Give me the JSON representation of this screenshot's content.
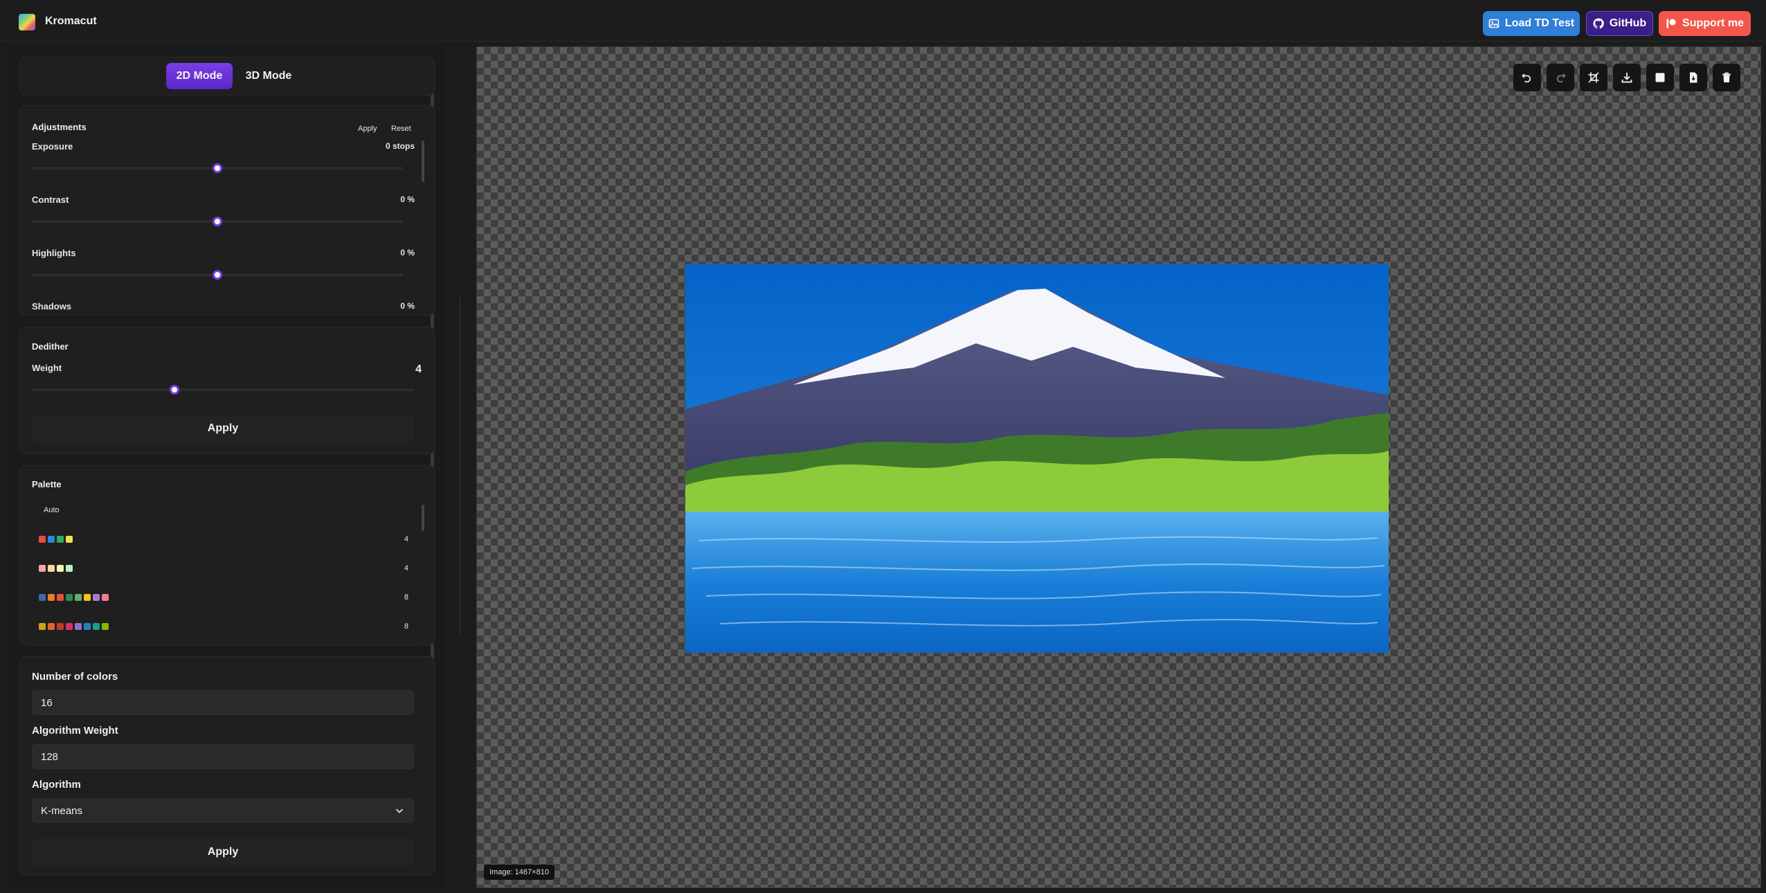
{
  "app": {
    "title": "Kromacut"
  },
  "header": {
    "load_td_label": "Load TD Test",
    "github_label": "GitHub",
    "support_label": "Support me"
  },
  "modes": {
    "mode_2d": "2D Mode",
    "mode_3d": "3D Mode",
    "active": "2D Mode"
  },
  "adjustments": {
    "title": "Adjustments",
    "apply_label": "Apply",
    "reset_label": "Reset",
    "items": [
      {
        "label": "Exposure",
        "value": "0 stops",
        "level": 0.5
      },
      {
        "label": "Contrast",
        "value": "0 %",
        "level": 0.5
      },
      {
        "label": "Highlights",
        "value": "0 %",
        "level": 0.5
      },
      {
        "label": "Shadows",
        "value": "0 %",
        "level": 0.5
      }
    ]
  },
  "dedither": {
    "title": "Dedither",
    "weight_label": "Weight",
    "weight_value": "4",
    "weight_level": 0.38,
    "apply_label": "Apply"
  },
  "palette": {
    "title": "Palette",
    "auto_label": "Auto",
    "rows": [
      {
        "colors": [
          "#e74c3c",
          "#2e86de",
          "#27ae60",
          "#f1e04a"
        ],
        "count": "4"
      },
      {
        "colors": [
          "#f4a6a6",
          "#f6d7a7",
          "#fdf3b0",
          "#b8f2c2"
        ],
        "count": "4"
      },
      {
        "colors": [
          "#3d6aa8",
          "#e67e22",
          "#e74c3c",
          "#2e8b57",
          "#6ca96b",
          "#f1c40f",
          "#a77bca",
          "#f37b96"
        ],
        "count": "8"
      },
      {
        "colors": [
          "#d4a017",
          "#e0672a",
          "#c0392b",
          "#d6336c",
          "#8e6fd8",
          "#2980b9",
          "#16a085",
          "#8db600"
        ],
        "count": "8"
      }
    ]
  },
  "quantize": {
    "num_colors_label": "Number of colors",
    "num_colors_value": "16",
    "algo_weight_label": "Algorithm Weight",
    "algo_weight_value": "128",
    "algorithm_label": "Algorithm",
    "algorithm_value": "K-means",
    "apply_label": "Apply"
  },
  "toolbar": {
    "icons": [
      "undo-icon",
      "redo-icon",
      "crop-icon",
      "download-icon",
      "square-icon",
      "file-icon",
      "trash-icon"
    ]
  },
  "canvas": {
    "image_info": "Image: 1467×810"
  }
}
